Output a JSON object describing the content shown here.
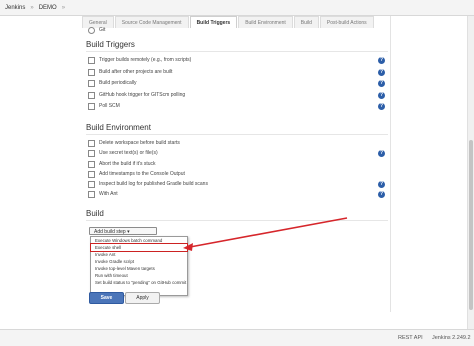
{
  "breadcrumb": {
    "root": "Jenkins",
    "sep": "»",
    "project": "DEMO",
    "sep2": "»"
  },
  "tabs": [
    "General",
    "Source Code Management",
    "Build Triggers",
    "Build Environment",
    "Build",
    "Post-build Actions"
  ],
  "top_partial_option": "Git",
  "build_triggers": {
    "title": "Build Triggers",
    "options": [
      "Trigger builds remotely (e.g., from scripts)",
      "Build after other projects are built",
      "Build periodically",
      "GitHub hook trigger for GITScm polling",
      "Poll SCM"
    ]
  },
  "build_environment": {
    "title": "Build Environment",
    "options": [
      "Delete workspace before build starts",
      "Use secret text(s) or file(s)",
      "Abort the build if it's stuck",
      "Add timestamps to the Console Output",
      "Inspect build log for published Gradle build scans",
      "With Ant"
    ]
  },
  "build": {
    "title": "Build",
    "add_step_label": "Add build step ▾",
    "menu": [
      "Execute Windows batch command",
      "Execute shell",
      "Invoke Ant",
      "Invoke Gradle script",
      "Invoke top-level Maven targets",
      "Run with timeout",
      "Set build status to \"pending\" on GitHub commit"
    ],
    "highlighted_index": 1
  },
  "buttons": {
    "save": "Save",
    "apply": "Apply"
  },
  "footer": {
    "rest_api": "REST API",
    "version": "Jenkins 2.249.2"
  },
  "help_glyph": "?",
  "colors": {
    "save_bg": "#4b75b9",
    "help_bg": "#2c5ea8",
    "arrow": "#d6262b"
  }
}
